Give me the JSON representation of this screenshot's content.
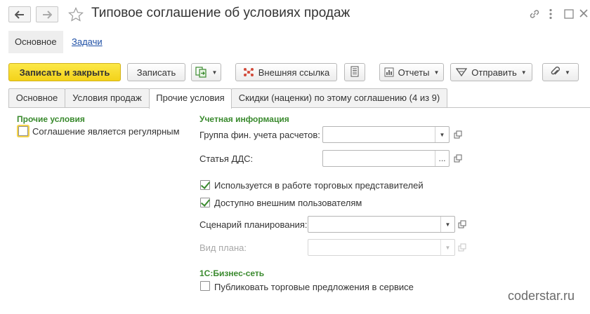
{
  "window": {
    "title": "Типовое соглашение об условиях продаж"
  },
  "sections": {
    "main": "Основное",
    "tasks": "Задачи"
  },
  "toolbar": {
    "save_close": "Записать и закрыть",
    "save": "Записать",
    "external_link": "Внешняя ссылка",
    "reports": "Отчеты",
    "send": "Отправить"
  },
  "tabs": [
    {
      "label": "Основное"
    },
    {
      "label": "Условия продаж"
    },
    {
      "label": "Прочие условия"
    },
    {
      "label": "Скидки (наценки) по этому соглашению (4 из 9)"
    }
  ],
  "active_tab": "Прочие условия",
  "other_conditions": {
    "heading": "Прочие условия",
    "regular_label": "Соглашение является регулярным",
    "regular_checked": false
  },
  "accounting": {
    "heading": "Учетная информация",
    "fin_group_label": "Группа фин. учета расчетов:",
    "fin_group_value": "",
    "dds_label": "Статья ДДС:",
    "dds_value": "",
    "sales_reps_label": "Используется в работе торговых представителей",
    "sales_reps_checked": true,
    "external_users_label": "Доступно внешним пользователям",
    "external_users_checked": true,
    "scenario_label": "Сценарий планирования:",
    "scenario_value": "",
    "plan_type_label": "Вид плана:",
    "plan_type_value": ""
  },
  "business_network": {
    "heading": "1С:Бизнес-сеть",
    "publish_label": "Публиковать торговые предложения в сервисе",
    "publish_checked": false
  },
  "watermark": "coderstar.ru",
  "colors": {
    "accent_yellow": "#f3d21a",
    "group_heading_green": "#3a8a2e",
    "link_blue": "#1e4fa5"
  }
}
